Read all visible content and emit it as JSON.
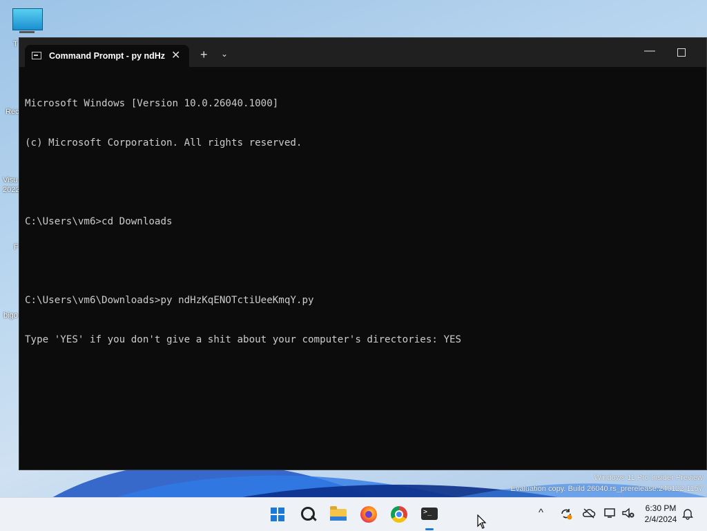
{
  "desktop": {
    "icons": [
      {
        "label": "T",
        "icon": "monitor-icon"
      },
      {
        "label": "Rec",
        "icon": "recycle-bin-icon"
      },
      {
        "label": "Visu",
        "label2": "2022",
        "icon": "visual-studio-icon"
      },
      {
        "label": "F",
        "icon": "firefox-icon"
      },
      {
        "label": "bigo",
        "icon": "file-icon"
      }
    ],
    "watermark": {
      "line1": "Windows 11 Pro Insider Preview",
      "line2": "Evaluation copy. Build 26040.rs_prerelease.240122-1157"
    }
  },
  "window": {
    "tab_title": "Command Prompt - py  ndHz",
    "tab_close": "✕",
    "new_tab": "+",
    "dropdown": "⌄",
    "minimize": "—"
  },
  "console": {
    "lines": [
      "Microsoft Windows [Version 10.0.26040.1000]",
      "(c) Microsoft Corporation. All rights reserved.",
      "",
      "C:\\Users\\vm6>cd Downloads",
      "",
      "C:\\Users\\vm6\\Downloads>py ndHzKqENOTctiUeeKmqY.py",
      "Type 'YES' if you don't give a shit about your computer's directories: YES"
    ]
  },
  "taskbar": {
    "apps": [
      "start-icon",
      "search-icon",
      "file-explorer-icon",
      "firefox-icon",
      "chrome-icon",
      "terminal-icon"
    ],
    "tray": {
      "chevron": "^",
      "time": "6:30 PM",
      "date": "2/4/2024"
    }
  },
  "colors": {
    "terminal_bg": "#0c0c0c",
    "titlebar_bg": "#202020",
    "console_text": "#cccccc",
    "taskbar_bg": "#eef2f7",
    "accent": "#1a78d6"
  }
}
